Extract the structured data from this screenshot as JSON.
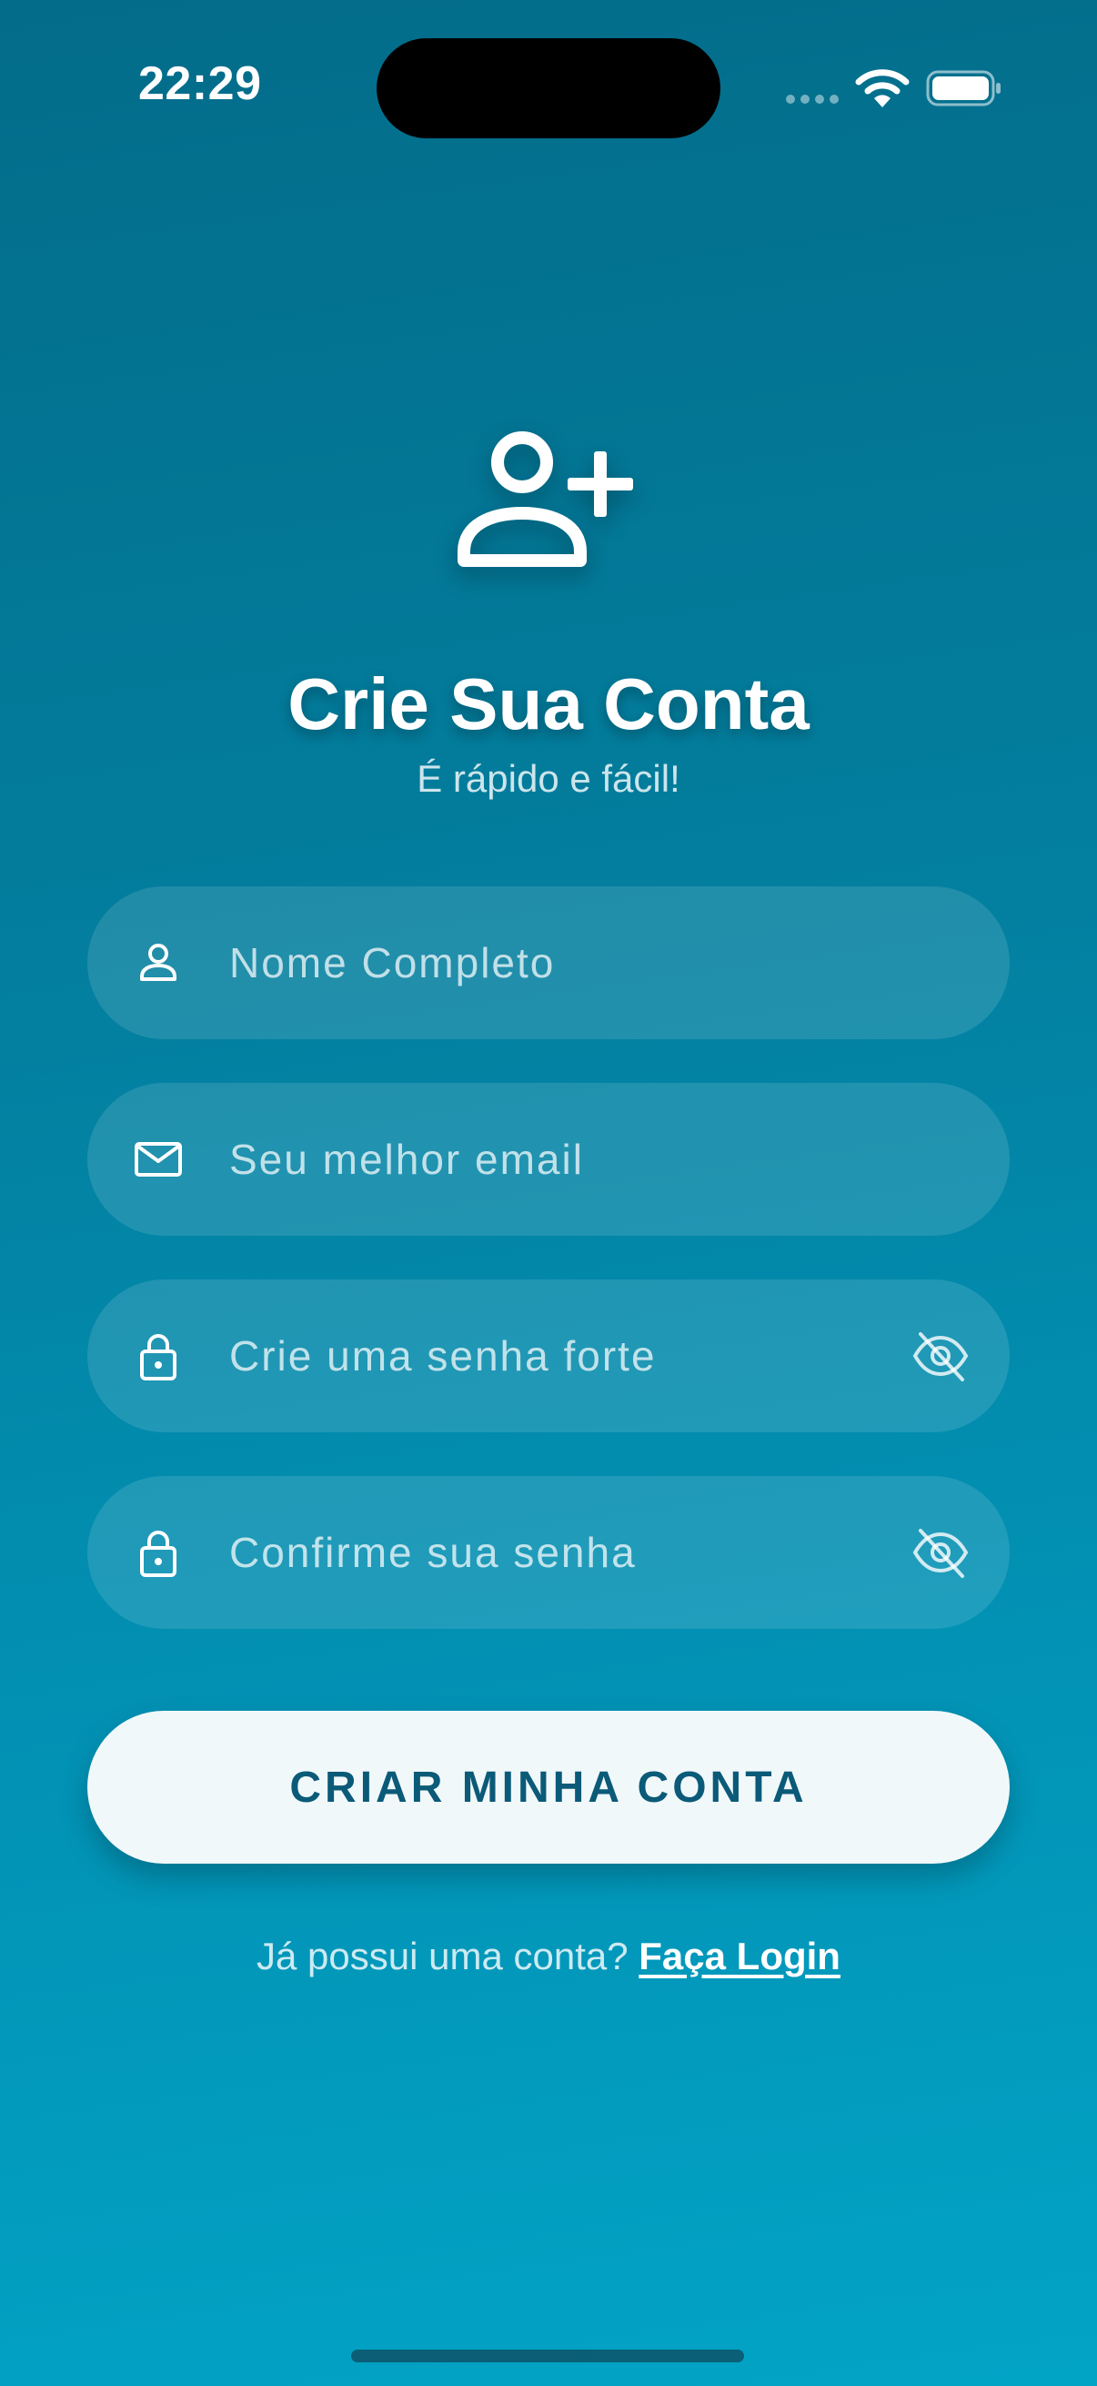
{
  "status_bar": {
    "time": "22:29",
    "icons": [
      "signal-icon",
      "wifi-icon",
      "battery-icon"
    ]
  },
  "header": {
    "icon": "add-user-icon",
    "title": "Crie Sua Conta",
    "subtitle": "É rápido e fácil!"
  },
  "form": {
    "name": {
      "placeholder": "Nome Completo",
      "value": "",
      "icon": "person-icon"
    },
    "email": {
      "placeholder": "Seu melhor email",
      "value": "",
      "icon": "mail-icon"
    },
    "password": {
      "placeholder": "Crie uma senha forte",
      "value": "",
      "icon": "lock-icon",
      "toggle_icon": "eye-off-icon"
    },
    "confirm_password": {
      "placeholder": "Confirme sua senha",
      "value": "",
      "icon": "lock-icon",
      "toggle_icon": "eye-off-icon"
    },
    "submit_label": "CRIAR MINHA CONTA"
  },
  "footer": {
    "prompt": "Já possui uma conta?",
    "login_label": "Faça Login"
  },
  "colors": {
    "background_top": "#036c8a",
    "background_bottom": "#02a4c6",
    "button_bg": "#f1f8fa",
    "button_text": "#0a5a78"
  }
}
